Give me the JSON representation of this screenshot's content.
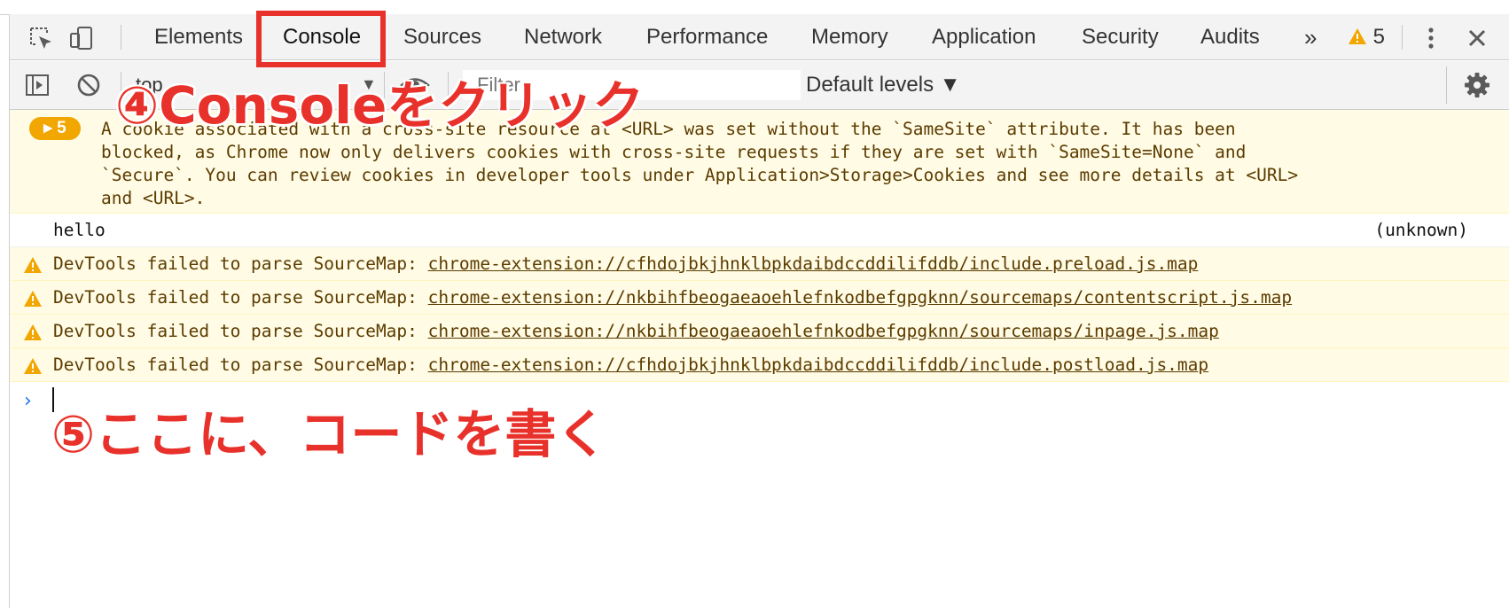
{
  "tabbar": {
    "tabs": [
      "Elements",
      "Console",
      "Sources",
      "Network",
      "Performance",
      "Memory",
      "Application",
      "Security",
      "Audits"
    ],
    "overflow_label": "»",
    "warning_count": "5",
    "menu_icon": "kebab-menu-icon",
    "close_icon": "close-icon",
    "inspect_icon": "inspect-element-icon",
    "device_icon": "device-toolbar-icon"
  },
  "console_toolbar": {
    "context": "top",
    "filter_placeholder": "Filter",
    "levels_label": "Default levels ▼",
    "sidebar_icon": "sidebar-toggle-icon",
    "clear_icon": "clear-console-icon",
    "eye_icon": "live-expression-eye-icon",
    "settings_icon": "gear-icon"
  },
  "messages": {
    "group_badge": "▸ 5",
    "cookie_lines": [
      "A cookie associated with a cross-site resource at <URL> was set without the `SameSite` attribute. It has been",
      "blocked, as Chrome now only delivers cookies with cross-site requests if they are set with `SameSite=None` and",
      "`Secure`. You can review cookies in developer tools under Application>Storage>Cookies and see more details at <URL>",
      "and <URL>."
    ],
    "log_text": "hello",
    "log_source": "(unknown)",
    "sourcemap_prefix": "DevTools failed to parse SourceMap: ",
    "sourcemap_urls": [
      "chrome-extension://cfhdojbkjhnklbpkdaibdccddilifddb/include.preload.js.map",
      "chrome-extension://nkbihfbeogaeaoehlefnkodbefgpgknn/sourcemaps/contentscript.js.map",
      "chrome-extension://nkbihfbeogaeaoehlefnkodbefgpgknn/sourcemaps/inpage.js.map",
      "chrome-extension://cfhdojbkjhnklbpkdaibdccddilifddb/include.postload.js.map"
    ]
  },
  "prompt": {
    "caret": "›",
    "value": ""
  },
  "annotations": {
    "step4": "④Consoleをクリック",
    "step5": "⑤ここに、コードを書く"
  },
  "colors": {
    "annotation_red": "#e8312a",
    "warning_yellow": "#f2a600",
    "warn_bg": "#fffbe5",
    "prompt_blue": "#1a73e8"
  }
}
